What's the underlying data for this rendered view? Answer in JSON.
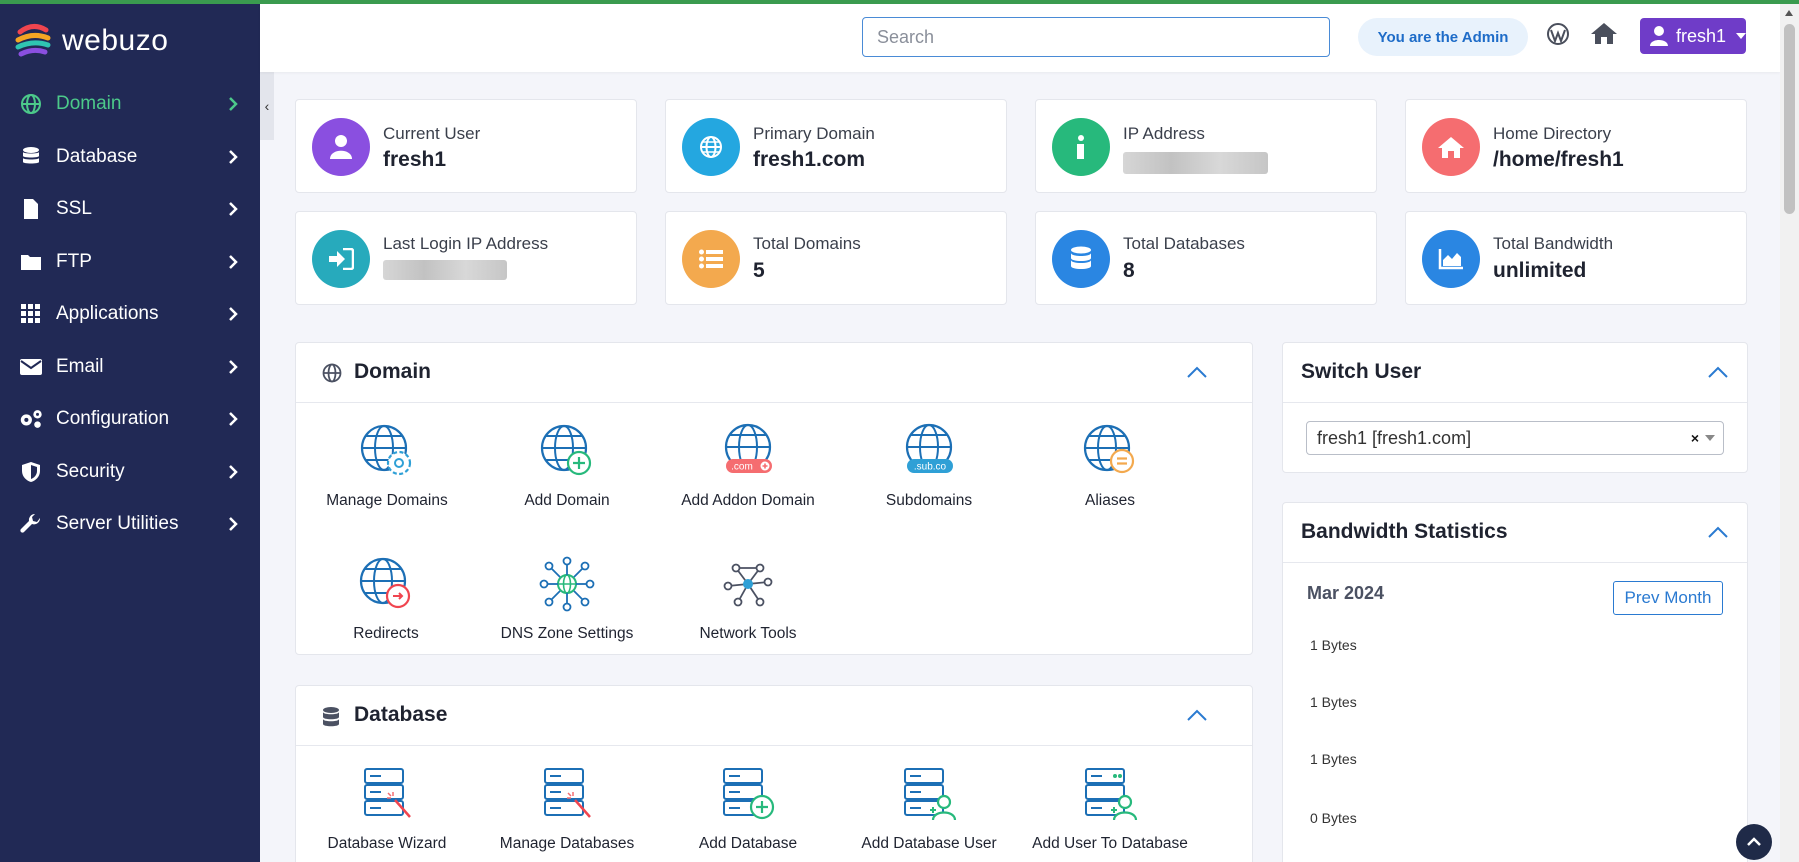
{
  "brand": {
    "name": "webuzo"
  },
  "sidebar": {
    "items": [
      {
        "label": "Domain",
        "icon": "globe-icon",
        "active": true
      },
      {
        "label": "Database",
        "icon": "database-icon"
      },
      {
        "label": "SSL",
        "icon": "file-icon"
      },
      {
        "label": "FTP",
        "icon": "folder-icon"
      },
      {
        "label": "Applications",
        "icon": "grid-icon"
      },
      {
        "label": "Email",
        "icon": "envelope-icon"
      },
      {
        "label": "Configuration",
        "icon": "gears-icon"
      },
      {
        "label": "Security",
        "icon": "shield-icon"
      },
      {
        "label": "Server Utilities",
        "icon": "wrench-icon"
      }
    ],
    "collapse_glyph": "‹"
  },
  "header": {
    "search_placeholder": "Search",
    "admin_badge": "You are the Admin",
    "user_menu": "fresh1"
  },
  "stats": [
    {
      "label": "Current User",
      "value": "fresh1",
      "color": "#8a4fe0",
      "icon": "user-icon"
    },
    {
      "label": "Primary Domain",
      "value": "fresh1.com",
      "color": "#24a7e0",
      "icon": "globe-icon"
    },
    {
      "label": "IP Address",
      "value": "",
      "color": "#27b97c",
      "icon": "info-icon"
    },
    {
      "label": "Home Directory",
      "value": "/home/fresh1",
      "color": "#f56d70",
      "icon": "home-icon"
    },
    {
      "label": "Last Login IP Address",
      "value": "",
      "color": "#27aabc",
      "icon": "sign-in-icon"
    },
    {
      "label": "Total Domains",
      "value": "5",
      "color": "#f3a94e",
      "icon": "list-icon"
    },
    {
      "label": "Total Databases",
      "value": "8",
      "color": "#2a86e2",
      "icon": "database-icon"
    },
    {
      "label": "Total Bandwidth",
      "value": "unlimited",
      "color": "#2a86e2",
      "icon": "area-chart-icon"
    }
  ],
  "domain_panel": {
    "title": "Domain",
    "tiles": [
      {
        "label": "Manage Domains"
      },
      {
        "label": "Add Domain"
      },
      {
        "label": "Add Addon Domain",
        "badge": ".com"
      },
      {
        "label": "Subdomains",
        "badge": ".sub.co"
      },
      {
        "label": "Aliases"
      },
      {
        "label": "Redirects"
      },
      {
        "label": "DNS Zone Settings"
      },
      {
        "label": "Network Tools"
      }
    ]
  },
  "database_panel": {
    "title": "Database",
    "tiles": [
      {
        "label": "Database Wizard"
      },
      {
        "label": "Manage Databases"
      },
      {
        "label": "Add Database"
      },
      {
        "label": "Add Database User"
      },
      {
        "label": "Add User To Database"
      }
    ]
  },
  "switch_user": {
    "title": "Switch User",
    "selected": "fresh1 [fresh1.com]",
    "clear_glyph": "×"
  },
  "bandwidth": {
    "title": "Bandwidth Statistics",
    "month": "Mar 2024",
    "prev_button": "Prev Month",
    "ticks": [
      "1 Bytes",
      "1 Bytes",
      "1 Bytes",
      "0 Bytes"
    ]
  }
}
